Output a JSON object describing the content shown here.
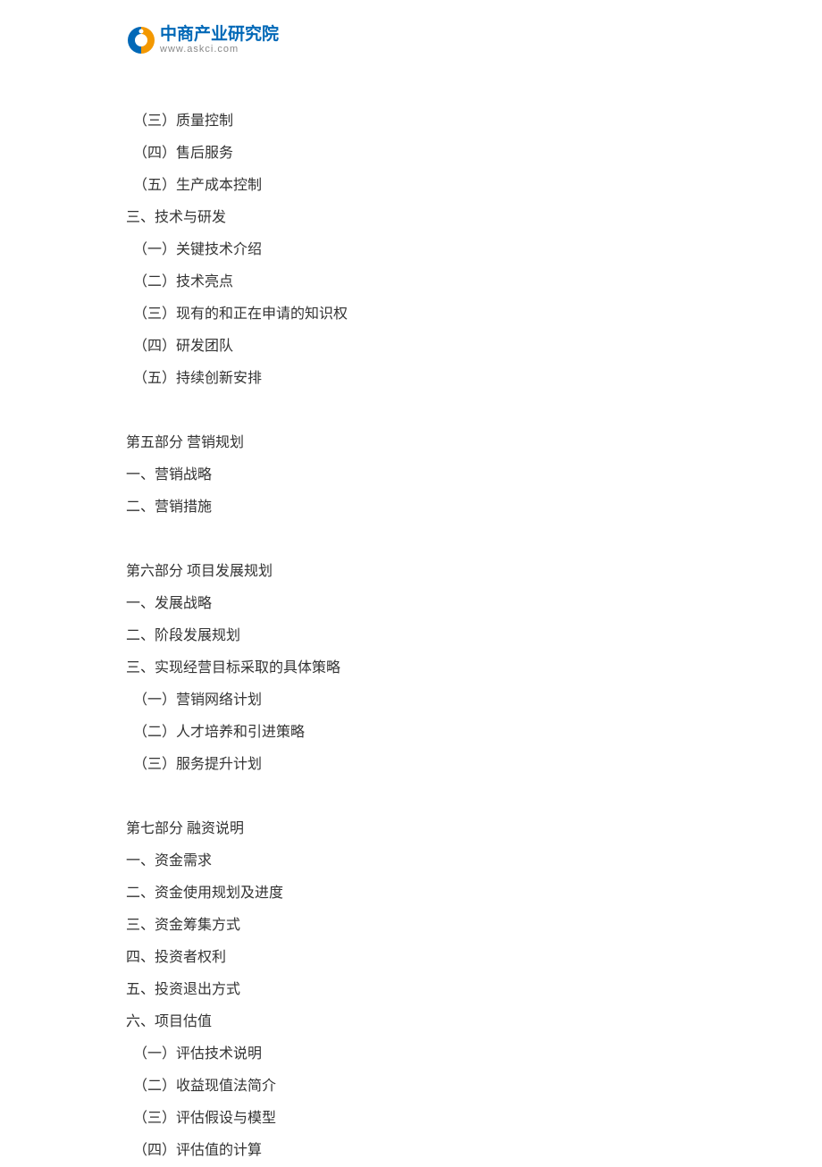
{
  "logo": {
    "title": "中商产业研究院",
    "url": "www.askci.com"
  },
  "lines": [
    {
      "text": "（三）质量控制",
      "indent": true
    },
    {
      "text": "（四）售后服务",
      "indent": true
    },
    {
      "text": "（五）生产成本控制",
      "indent": true
    },
    {
      "text": "三、技术与研发",
      "indent": false
    },
    {
      "text": "（一）关键技术介绍",
      "indent": true
    },
    {
      "text": "（二）技术亮点",
      "indent": true
    },
    {
      "text": "（三）现有的和正在申请的知识权",
      "indent": true
    },
    {
      "text": "（四）研发团队",
      "indent": true
    },
    {
      "text": "（五）持续创新安排",
      "indent": true
    },
    {
      "text": "",
      "gap": true
    },
    {
      "text": "第五部分 营销规划",
      "indent": false
    },
    {
      "text": "一、营销战略",
      "indent": false
    },
    {
      "text": "二、营销措施",
      "indent": false
    },
    {
      "text": "",
      "gap": true
    },
    {
      "text": "第六部分 项目发展规划",
      "indent": false
    },
    {
      "text": "一、发展战略",
      "indent": false
    },
    {
      "text": "二、阶段发展规划",
      "indent": false
    },
    {
      "text": "三、实现经营目标采取的具体策略",
      "indent": false
    },
    {
      "text": "（一）营销网络计划",
      "indent": true
    },
    {
      "text": "（二）人才培养和引进策略",
      "indent": true
    },
    {
      "text": "（三）服务提升计划",
      "indent": true
    },
    {
      "text": "",
      "gap": true
    },
    {
      "text": "第七部分 融资说明",
      "indent": false
    },
    {
      "text": "一、资金需求",
      "indent": false
    },
    {
      "text": "二、资金使用规划及进度",
      "indent": false
    },
    {
      "text": "三、资金筹集方式",
      "indent": false
    },
    {
      "text": "四、投资者权利",
      "indent": false
    },
    {
      "text": "五、投资退出方式",
      "indent": false
    },
    {
      "text": "六、项目估值",
      "indent": false
    },
    {
      "text": "（一）评估技术说明",
      "indent": true
    },
    {
      "text": "（二）收益现值法简介",
      "indent": true
    },
    {
      "text": "（三）评估假设与模型",
      "indent": true
    },
    {
      "text": "（四）评估值的计算",
      "indent": true
    }
  ]
}
